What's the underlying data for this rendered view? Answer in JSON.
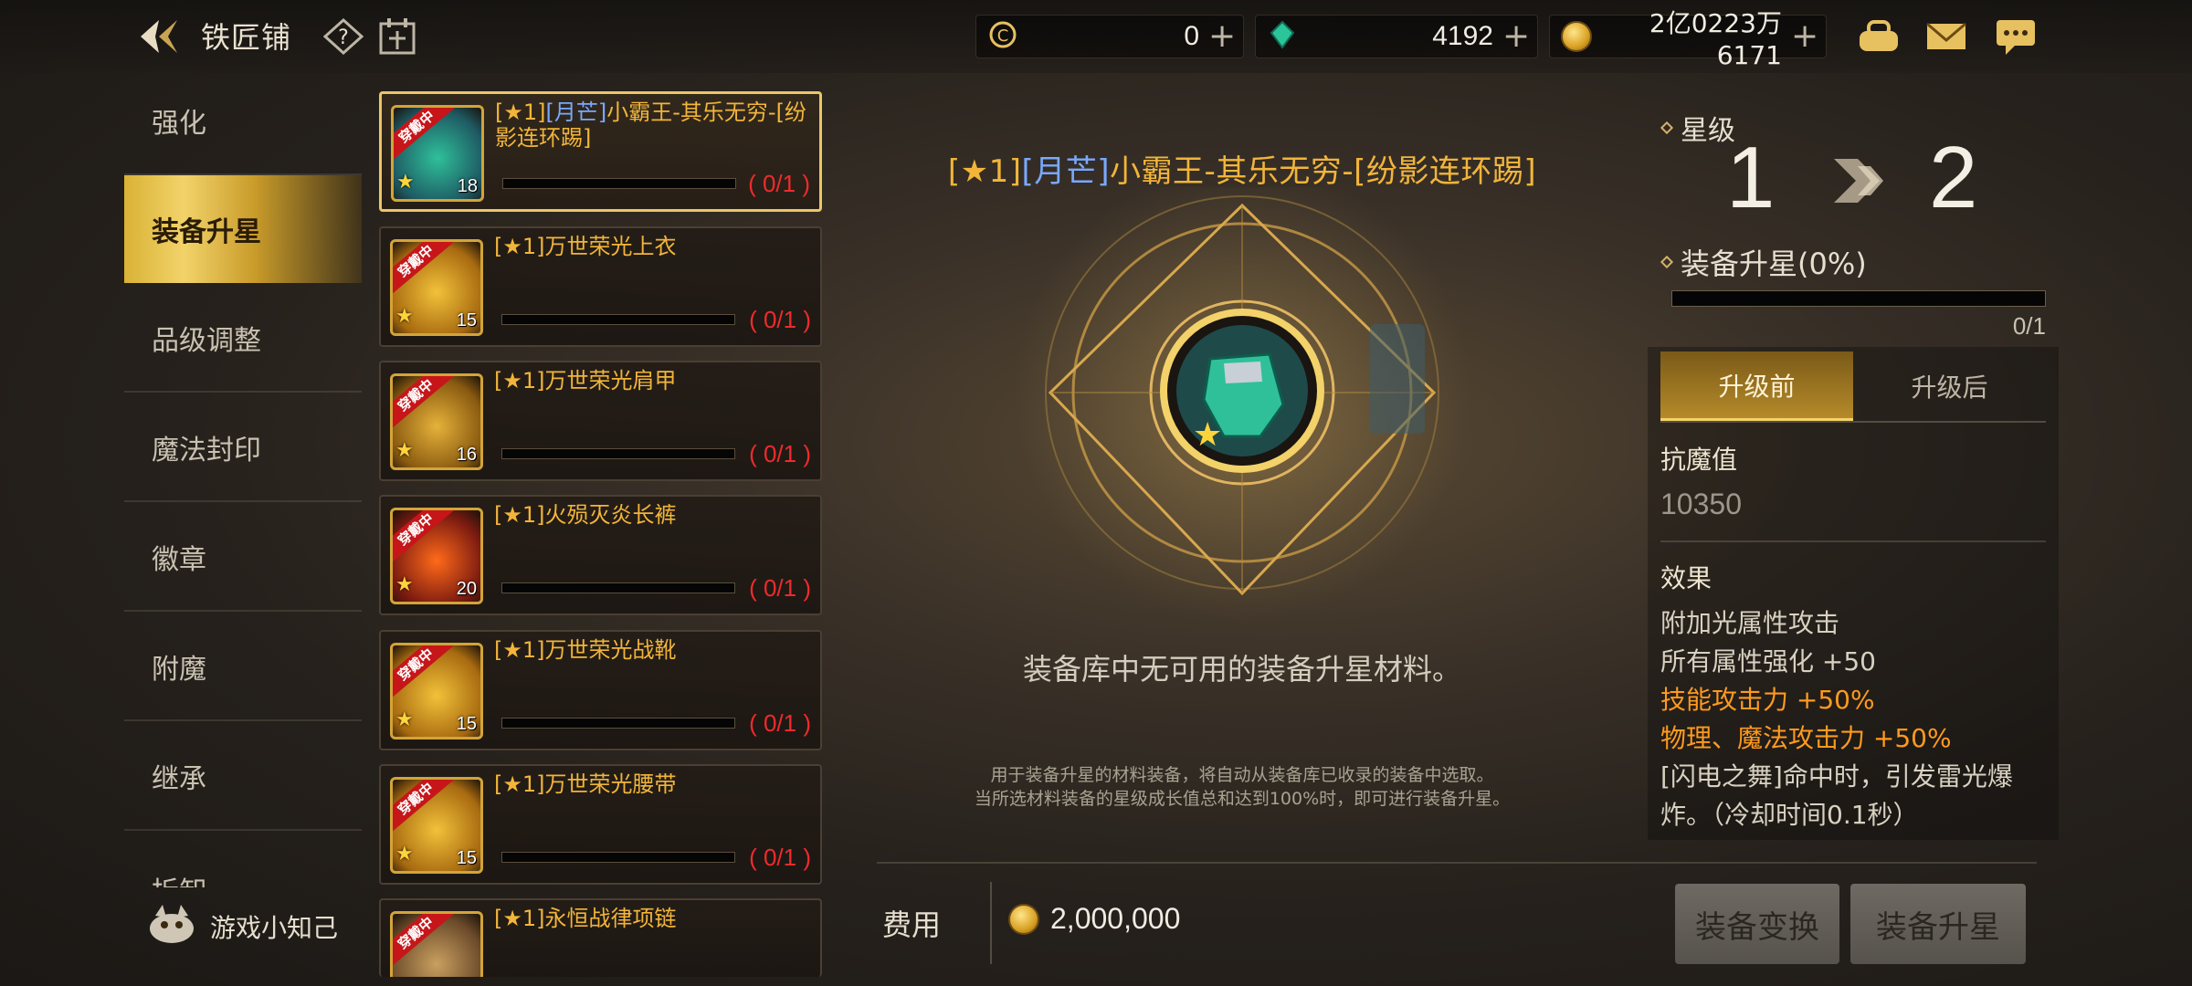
{
  "header": {
    "title": "铁匠铺",
    "currencies": [
      {
        "icon": "c-currency-icon",
        "value": "0"
      },
      {
        "icon": "gem-icon",
        "value": "4192"
      },
      {
        "icon": "gold-coin-icon",
        "value": "2亿0223万6171"
      }
    ]
  },
  "nav": {
    "items": [
      {
        "label": "强化"
      },
      {
        "label": "装备升星"
      },
      {
        "label": "品级调整"
      },
      {
        "label": "魔法封印"
      },
      {
        "label": "徽章"
      },
      {
        "label": "附魔"
      },
      {
        "label": "继承"
      },
      {
        "label": "拆卸"
      }
    ],
    "active_index": 1,
    "tips_label": "游戏小知己"
  },
  "items": [
    {
      "prefix": "[★1]",
      "blue": "[月芒]",
      "name": "小霸王-其乐无穷-[纷影连环踢]",
      "level": "18",
      "count": "( 0/1 )",
      "ribbon": "穿戴中",
      "selected": true
    },
    {
      "prefix": "[★1]",
      "blue": "",
      "name": "万世荣光上衣",
      "level": "15",
      "count": "( 0/1 )",
      "ribbon": "穿戴中"
    },
    {
      "prefix": "[★1]",
      "blue": "",
      "name": "万世荣光肩甲",
      "level": "16",
      "count": "( 0/1 )",
      "ribbon": "穿戴中"
    },
    {
      "prefix": "[★1]",
      "blue": "",
      "name": "火殒灭炎长裤",
      "level": "20",
      "count": "( 0/1 )",
      "ribbon": "穿戴中"
    },
    {
      "prefix": "[★1]",
      "blue": "",
      "name": "万世荣光战靴",
      "level": "15",
      "count": "( 0/1 )",
      "ribbon": "穿戴中"
    },
    {
      "prefix": "[★1]",
      "blue": "",
      "name": "万世荣光腰带",
      "level": "15",
      "count": "( 0/1 )",
      "ribbon": "穿戴中"
    },
    {
      "prefix": "[★1]",
      "blue": "",
      "name": "永恒战律项链",
      "level": "",
      "count": "",
      "ribbon": "穿戴中"
    }
  ],
  "center": {
    "title_prefix": "[★1]",
    "title_blue": "[月芒]",
    "title_name": "小霸王-其乐无穷-[纷影连环踢]",
    "no_material": "装备库中无可用的装备升星材料。",
    "note_line1": "用于装备升星的材料装备，将自动从装备库已收录的装备中选取。",
    "note_line2": "当所选材料装备的星级成长值总和达到100%时，即可进行装备升星。",
    "cost_label": "费用",
    "cost_value": "2,000,000"
  },
  "right": {
    "star_label": "星级",
    "star_from": "1",
    "star_to": "2",
    "upgrade_label": "装备升星(0%)",
    "progress_text": "0/1",
    "progress_fraction": 0,
    "tabs": [
      "升级前",
      "升级后"
    ],
    "active_tab": 0,
    "stat_label": "抗魔值",
    "stat_value": "10350",
    "effect_label": "效果",
    "effects": [
      {
        "text": "附加光属性攻击",
        "highlight": false
      },
      {
        "text": "所有属性强化 +50",
        "highlight": false
      },
      {
        "text": "技能攻击力 +50%",
        "highlight": true
      },
      {
        "text": "物理、魔法攻击力 +50%",
        "highlight": true
      },
      {
        "text": "[闪电之舞]命中时，引发雷光爆",
        "highlight": false
      },
      {
        "text": "炸。（冷却时间0.1秒）",
        "highlight": false
      }
    ]
  },
  "buttons": {
    "convert": "装备变换",
    "upgrade": "装备升星"
  },
  "colors": {
    "gold_text": "#f2b53a",
    "blue_text": "#78a9ff",
    "count_red": "#ee2b2b",
    "highlight_orange": "#ff9a1e",
    "nav_active": "#e2bd46"
  }
}
